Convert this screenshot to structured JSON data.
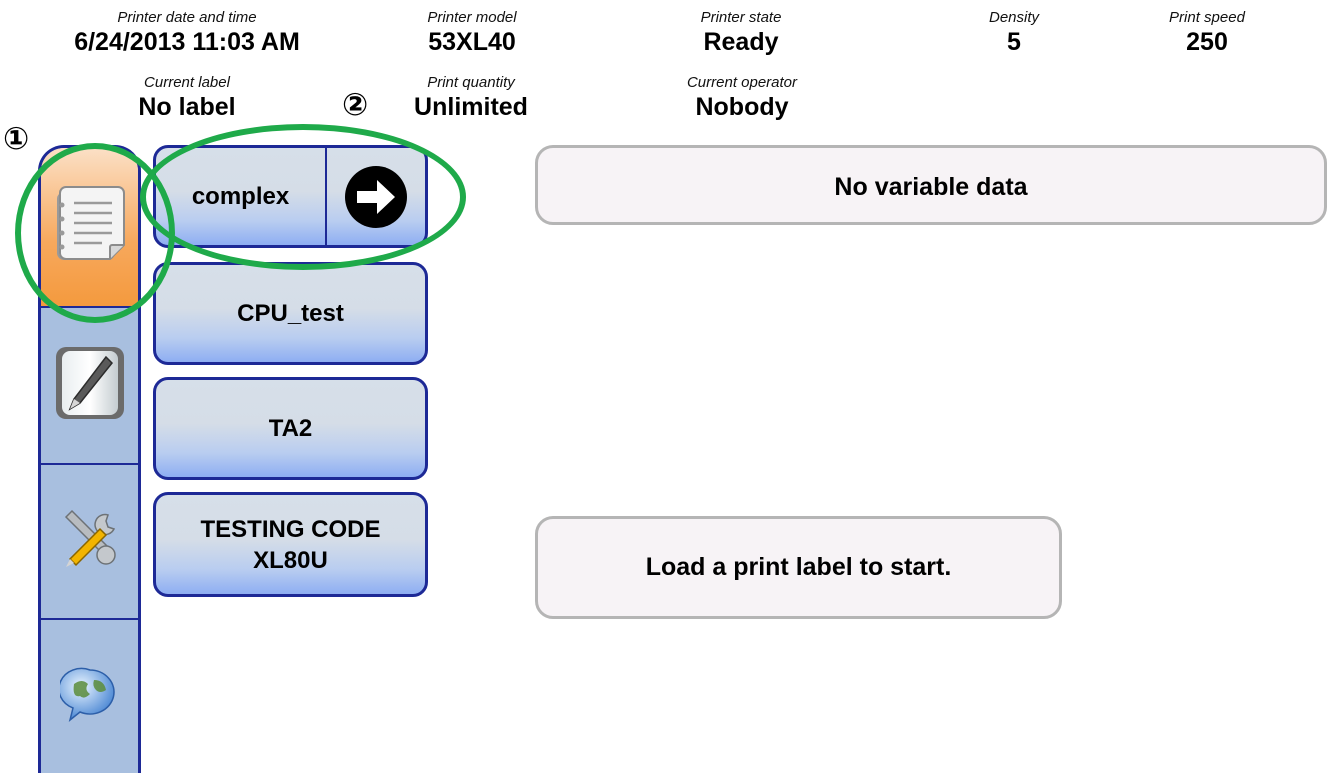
{
  "status": {
    "printer_datetime": {
      "caption": "Printer date and time",
      "value": "6/24/2013 11:03 AM"
    },
    "printer_model": {
      "caption": "Printer model",
      "value": "53XL40"
    },
    "printer_state": {
      "caption": "Printer state",
      "value": "Ready"
    },
    "density": {
      "caption": "Density",
      "value": "5"
    },
    "print_speed": {
      "caption": "Print speed",
      "value": "250"
    },
    "current_label": {
      "caption": "Current label",
      "value": "No label"
    },
    "print_quantity": {
      "caption": "Print quantity",
      "value": "Unlimited"
    },
    "current_operator": {
      "caption": "Current operator",
      "value": "Nobody"
    }
  },
  "markers": {
    "one": "①",
    "two": "②"
  },
  "sidebar": {
    "items": [
      {
        "icon": "document-list-icon",
        "active": true
      },
      {
        "icon": "edit-pen-icon",
        "active": false
      },
      {
        "icon": "tools-icon",
        "active": false
      },
      {
        "icon": "globe-chat-icon",
        "active": false
      }
    ]
  },
  "labels": [
    {
      "name": "complex",
      "selected": true
    },
    {
      "name": "CPU_test"
    },
    {
      "name": "TA2"
    },
    {
      "name_line1": "TESTING CODE",
      "name_line2": "XL80U"
    }
  ],
  "variable_data_panel": {
    "text": "No variable data"
  },
  "message_panel": {
    "text": "Load a print label to start."
  },
  "colors": {
    "sidebar": "#a8bfdf",
    "border": "#1d2996",
    "active_tab": "#f49a3e",
    "highlight": "#1faa4a"
  }
}
